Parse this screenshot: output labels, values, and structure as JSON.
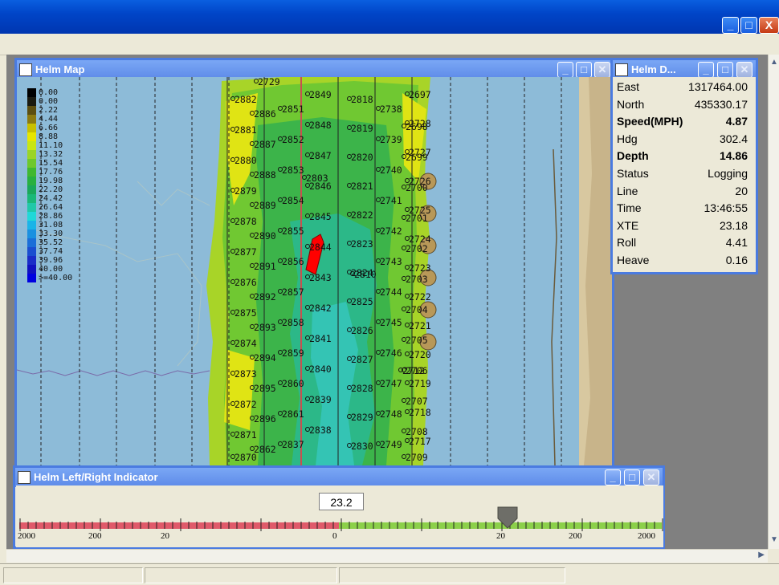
{
  "windows": {
    "map_title": "Helm Map",
    "data_title": "Helm D...",
    "indicator_title": "Helm Left/Right Indicator"
  },
  "main_window": {
    "buttons": {
      "minimize": "_",
      "maximize": "□",
      "close": "X"
    }
  },
  "legend": [
    {
      "label": "0.00",
      "color": "#000000"
    },
    {
      "label": "0.00",
      "color": "#1a1a10"
    },
    {
      "label": "2.22",
      "color": "#5c4e10"
    },
    {
      "label": "4.44",
      "color": "#8c7a10"
    },
    {
      "label": "6.66",
      "color": "#c8c000"
    },
    {
      "label": "8.88",
      "color": "#e6e600"
    },
    {
      "label": "11.10",
      "color": "#c8e614"
    },
    {
      "label": "13.32",
      "color": "#9ad428"
    },
    {
      "label": "15.54",
      "color": "#6ec82c"
    },
    {
      "label": "17.76",
      "color": "#40b830"
    },
    {
      "label": "19.98",
      "color": "#28b040"
    },
    {
      "label": "22.20",
      "color": "#1aa85a"
    },
    {
      "label": "24.42",
      "color": "#1ab878"
    },
    {
      "label": "26.64",
      "color": "#20c8a8"
    },
    {
      "label": "28.86",
      "color": "#20d8d8"
    },
    {
      "label": "31.08",
      "color": "#1ab4e8"
    },
    {
      "label": "33.30",
      "color": "#1a90e0"
    },
    {
      "label": "35.52",
      "color": "#1a6ed8"
    },
    {
      "label": "37.74",
      "color": "#1a4ed0"
    },
    {
      "label": "39.96",
      "color": "#1a2cc8"
    },
    {
      "label": "40.00",
      "color": "#1010c0"
    },
    {
      "label": ">=40.00",
      "color": "#0000e0"
    }
  ],
  "line_numbers": {
    "col_a": [
      "2882",
      "2881",
      "2880",
      "2879",
      "2878",
      "2877",
      "2876",
      "2875",
      "2874",
      "2873",
      "2872",
      "2871",
      "2870"
    ],
    "col_b": [
      "2886",
      "2887",
      "2888",
      "2889",
      "2890",
      "2891",
      "2892",
      "2893",
      "2894",
      "2895",
      "2896",
      "2862"
    ],
    "col_c": [
      "2851",
      "2852",
      "2853",
      "2854",
      "2855",
      "2856",
      "2857",
      "2858",
      "2859",
      "2860",
      "2861",
      "2837"
    ],
    "col_d": [
      "2849",
      "2848",
      "2847",
      "2846",
      "2845",
      "2844",
      "2843",
      "2842",
      "2841",
      "2840",
      "2839",
      "2838"
    ],
    "col_e": [
      "2818",
      "2819",
      "2820",
      "2821",
      "2822",
      "2823",
      "2824",
      "2825",
      "2826",
      "2827",
      "2828",
      "2829",
      "2830"
    ],
    "col_f": [
      "2738",
      "2739",
      "2740",
      "2741",
      "2742",
      "2743",
      "2744",
      "2745",
      "2746",
      "2747",
      "2748",
      "2749"
    ],
    "col_g": [
      "2697",
      "2728",
      "2727",
      "2726",
      "2725",
      "2724",
      "2723",
      "2722",
      "2721",
      "2720",
      "2719",
      "2718",
      "2717"
    ],
    "col_h": [
      "2698",
      "2699",
      "2700",
      "2701",
      "2702",
      "2703",
      "2704",
      "2705",
      "2706",
      "2707",
      "2708",
      "2709"
    ],
    "extra": [
      "2729",
      "2803",
      "2810",
      "2712"
    ]
  },
  "data_panel": [
    {
      "key": "East",
      "value": "1317464.00",
      "bold": false
    },
    {
      "key": "North",
      "value": "435330.17",
      "bold": false
    },
    {
      "key": "Speed(MPH)",
      "value": "4.87",
      "bold": true
    },
    {
      "key": "Hdg",
      "value": "302.4",
      "bold": false
    },
    {
      "key": "Depth",
      "value": "14.86",
      "bold": true
    },
    {
      "key": "Status",
      "value": "Logging",
      "bold": false
    },
    {
      "key": "Line",
      "value": "20",
      "bold": false
    },
    {
      "key": "Time",
      "value": "13:46:55",
      "bold": false
    },
    {
      "key": "XTE",
      "value": "23.18",
      "bold": false
    },
    {
      "key": "Roll",
      "value": "4.41",
      "bold": false
    },
    {
      "key": "Heave",
      "value": "0.16",
      "bold": false
    }
  ],
  "indicator": {
    "value": "23.2",
    "tick_labels": [
      "2000",
      "200",
      "20",
      "0",
      "20",
      "200",
      "2000"
    ],
    "pointer_fraction": 0.76
  },
  "colors": {
    "title_blue": "#0045c8",
    "child_border": "#4a7be0",
    "water": "#8dbbd8",
    "shore": "#c8b48a",
    "boat": "#ff0000",
    "scale_left": "#e05a6a",
    "scale_right": "#8cd04a"
  }
}
